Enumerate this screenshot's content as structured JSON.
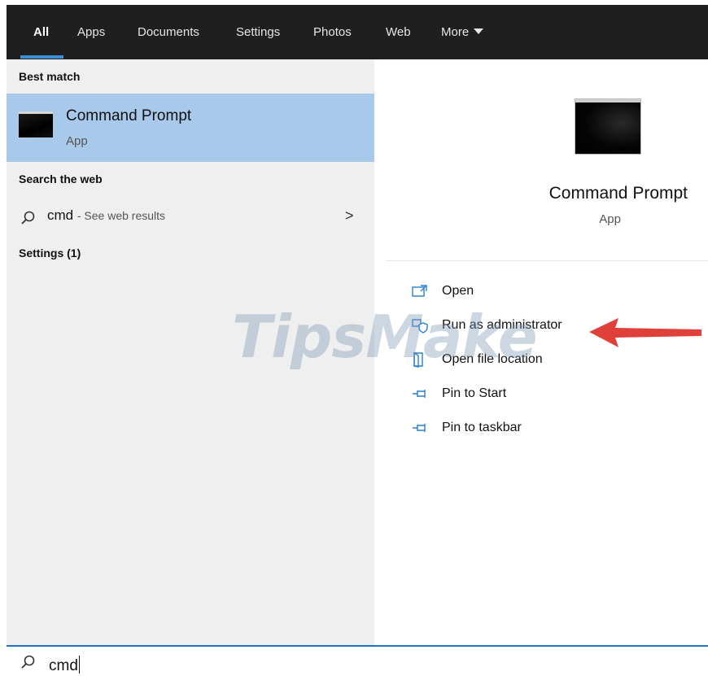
{
  "tabs": [
    {
      "label": "All",
      "active": true
    },
    {
      "label": "Apps"
    },
    {
      "label": "Documents"
    },
    {
      "label": "Settings"
    },
    {
      "label": "Photos"
    },
    {
      "label": "Web"
    },
    {
      "label": "More"
    }
  ],
  "left": {
    "best_match_header": "Best match",
    "best_match": {
      "title": "Command Prompt",
      "subtitle": "App",
      "icon": "command-prompt-icon"
    },
    "search_web_header": "Search the web",
    "web_result": {
      "query": "cmd",
      "hint": "- See web results",
      "icon": "search-icon",
      "chevron": ">"
    },
    "settings_header": "Settings (1)"
  },
  "right": {
    "title": "Command Prompt",
    "subtitle": "App",
    "actions": [
      {
        "label": "Open",
        "icon": "open-icon"
      },
      {
        "label": "Run as administrator",
        "icon": "shield-icon"
      },
      {
        "label": "Open file location",
        "icon": "file-location-icon"
      },
      {
        "label": "Pin to Start",
        "icon": "pin-icon"
      },
      {
        "label": "Pin to taskbar",
        "icon": "pin-icon"
      }
    ]
  },
  "search": {
    "value": "cmd",
    "icon": "search-icon"
  },
  "watermark": "TipsMake",
  "colors": {
    "accent": "#3a8fd6",
    "selected": "#a8c9ea",
    "topbar": "#1f1f1f",
    "annotation_arrow": "#e0403a"
  }
}
